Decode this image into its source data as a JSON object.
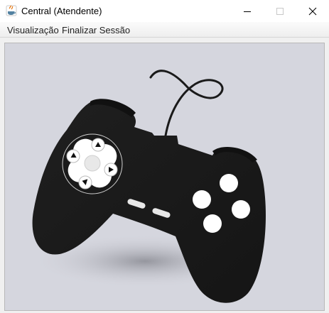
{
  "window": {
    "title": "Central (Atendente)",
    "icon": "java-coffee-icon"
  },
  "window_controls": {
    "minimize_icon": "minimize-icon",
    "maximize_icon": "maximize-icon",
    "close_icon": "close-icon"
  },
  "menubar": {
    "items": [
      {
        "label": "Visualização"
      },
      {
        "label": "Finalizar Sessão"
      }
    ]
  },
  "content": {
    "image": "gamepad-controller-image",
    "colors": {
      "background": "#d5d6de",
      "controller": "#1a1a1a",
      "buttons": "#ffffff"
    }
  }
}
